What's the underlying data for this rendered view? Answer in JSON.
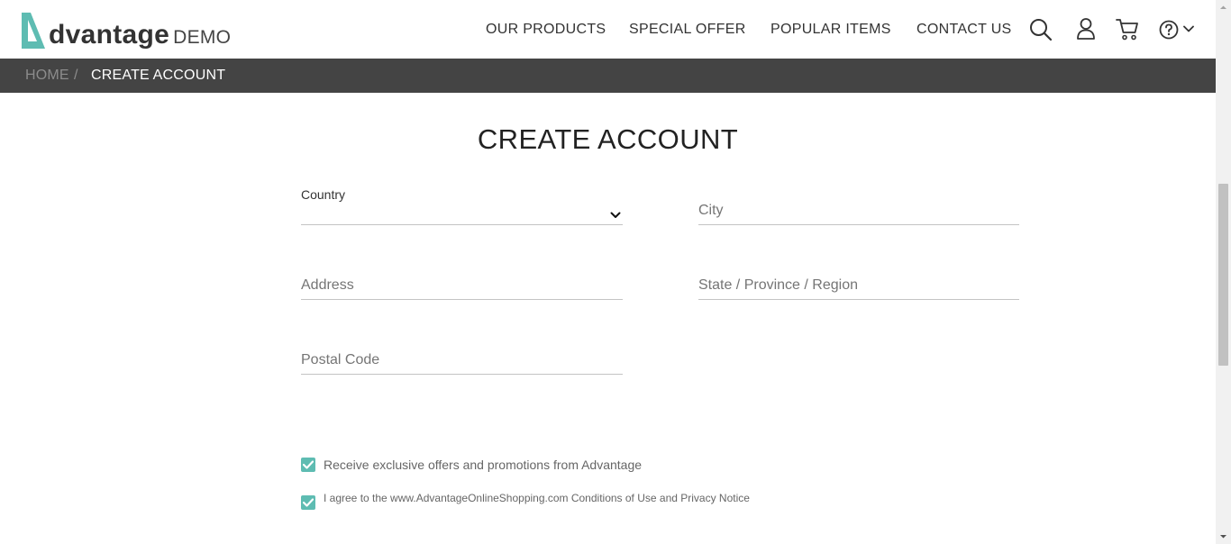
{
  "header": {
    "logo_word": "dvantage",
    "logo_demo": "DEMO",
    "nav": [
      "OUR PRODUCTS",
      "SPECIAL OFFER",
      "POPULAR ITEMS",
      "CONTACT US"
    ],
    "icons": [
      "search-icon",
      "user-icon",
      "cart-icon",
      "help-icon",
      "chevron-down-icon"
    ]
  },
  "breadcrumb": {
    "home": "HOME",
    "separator": "/",
    "current": "CREATE ACCOUNT"
  },
  "page": {
    "title": "CREATE ACCOUNT"
  },
  "form": {
    "country_label": "Country",
    "country_value": "",
    "city_placeholder": "City",
    "address_placeholder": "Address",
    "state_placeholder": "State / Province / Region",
    "postal_placeholder": "Postal Code"
  },
  "checks": {
    "offers_label": "Receive exclusive offers and promotions from Advantage",
    "offers_checked": true,
    "agree_label": "I agree to the www.AdvantageOnlineShopping.com Conditions of Use and Privacy Notice",
    "agree_checked": true
  },
  "colors": {
    "accent": "#5ebcb2",
    "breadcrumb_bg": "#444444"
  }
}
